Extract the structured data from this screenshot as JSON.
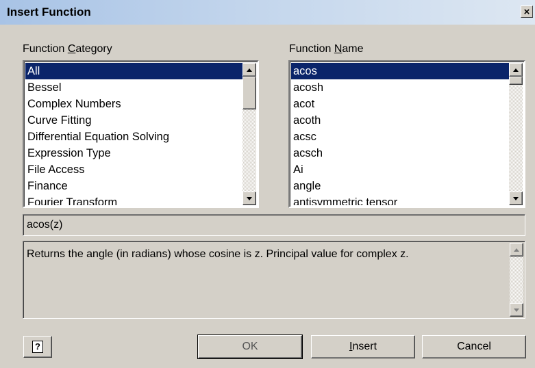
{
  "dialog": {
    "title": "Insert Function",
    "close_glyph": "×"
  },
  "category": {
    "label_pre": "Function ",
    "label_accel": "C",
    "label_post": "ategory",
    "items": [
      "All",
      "Bessel",
      "Complex Numbers",
      "Curve Fitting",
      "Differential Equation Solving",
      "Expression Type",
      "File Access",
      "Finance",
      "Fourier Transform"
    ],
    "selected": "All"
  },
  "function": {
    "label_pre": "Function ",
    "label_accel": "N",
    "label_post": "ame",
    "items": [
      "acos",
      "acosh",
      "acot",
      "acoth",
      "acsc",
      "acsch",
      "Ai",
      "angle",
      "antisymmetric tensor"
    ],
    "selected": "acos"
  },
  "syntax": "acos(z)",
  "description": "Returns the angle (in radians) whose cosine is z. Principal value for complex z.",
  "buttons": {
    "help_glyph": "?",
    "ok": "OK",
    "insert_accel": "I",
    "insert_rest": "nsert",
    "cancel": "Cancel"
  },
  "icons": {
    "close": "close-icon",
    "help": "help-icon",
    "scroll_up": "scroll-up-arrow-icon",
    "scroll_down": "scroll-down-arrow-icon"
  },
  "colors": {
    "selection": "#0a246a",
    "dialog_face": "#d4d0c8",
    "title_gradient_start": "#a8c3e6",
    "title_gradient_end": "#dde7f2"
  }
}
